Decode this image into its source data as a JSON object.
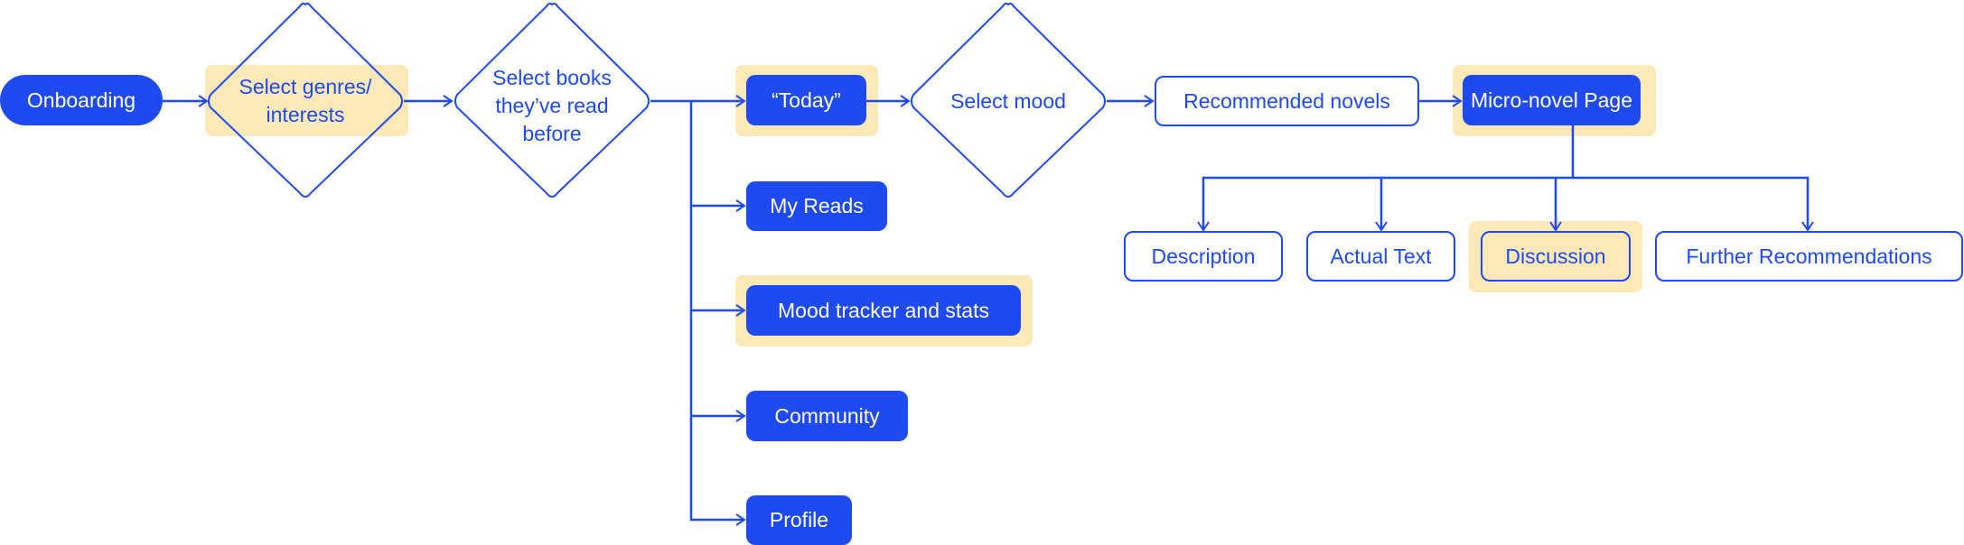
{
  "colors": {
    "primary": "#1f4af0",
    "highlight": "#fde8b7"
  },
  "nodes": {
    "onboarding": "Onboarding",
    "select_genres": "Select genres/ interests",
    "select_books": "Select books they’ve read before",
    "today": "“Today”",
    "select_mood": "Select mood",
    "recommended_novels": "Recommended novels",
    "micro_novel_page": "Micro-novel Page",
    "description": "Description",
    "actual_text": "Actual Text",
    "discussion": "Discussion",
    "further_recommendations": "Further Recommendations",
    "my_reads": "My Reads",
    "mood_tracker": "Mood tracker and stats",
    "community": "Community",
    "profile": "Profile"
  },
  "highlighted": [
    "select_genres",
    "today",
    "micro_novel_page",
    "discussion",
    "mood_tracker"
  ]
}
